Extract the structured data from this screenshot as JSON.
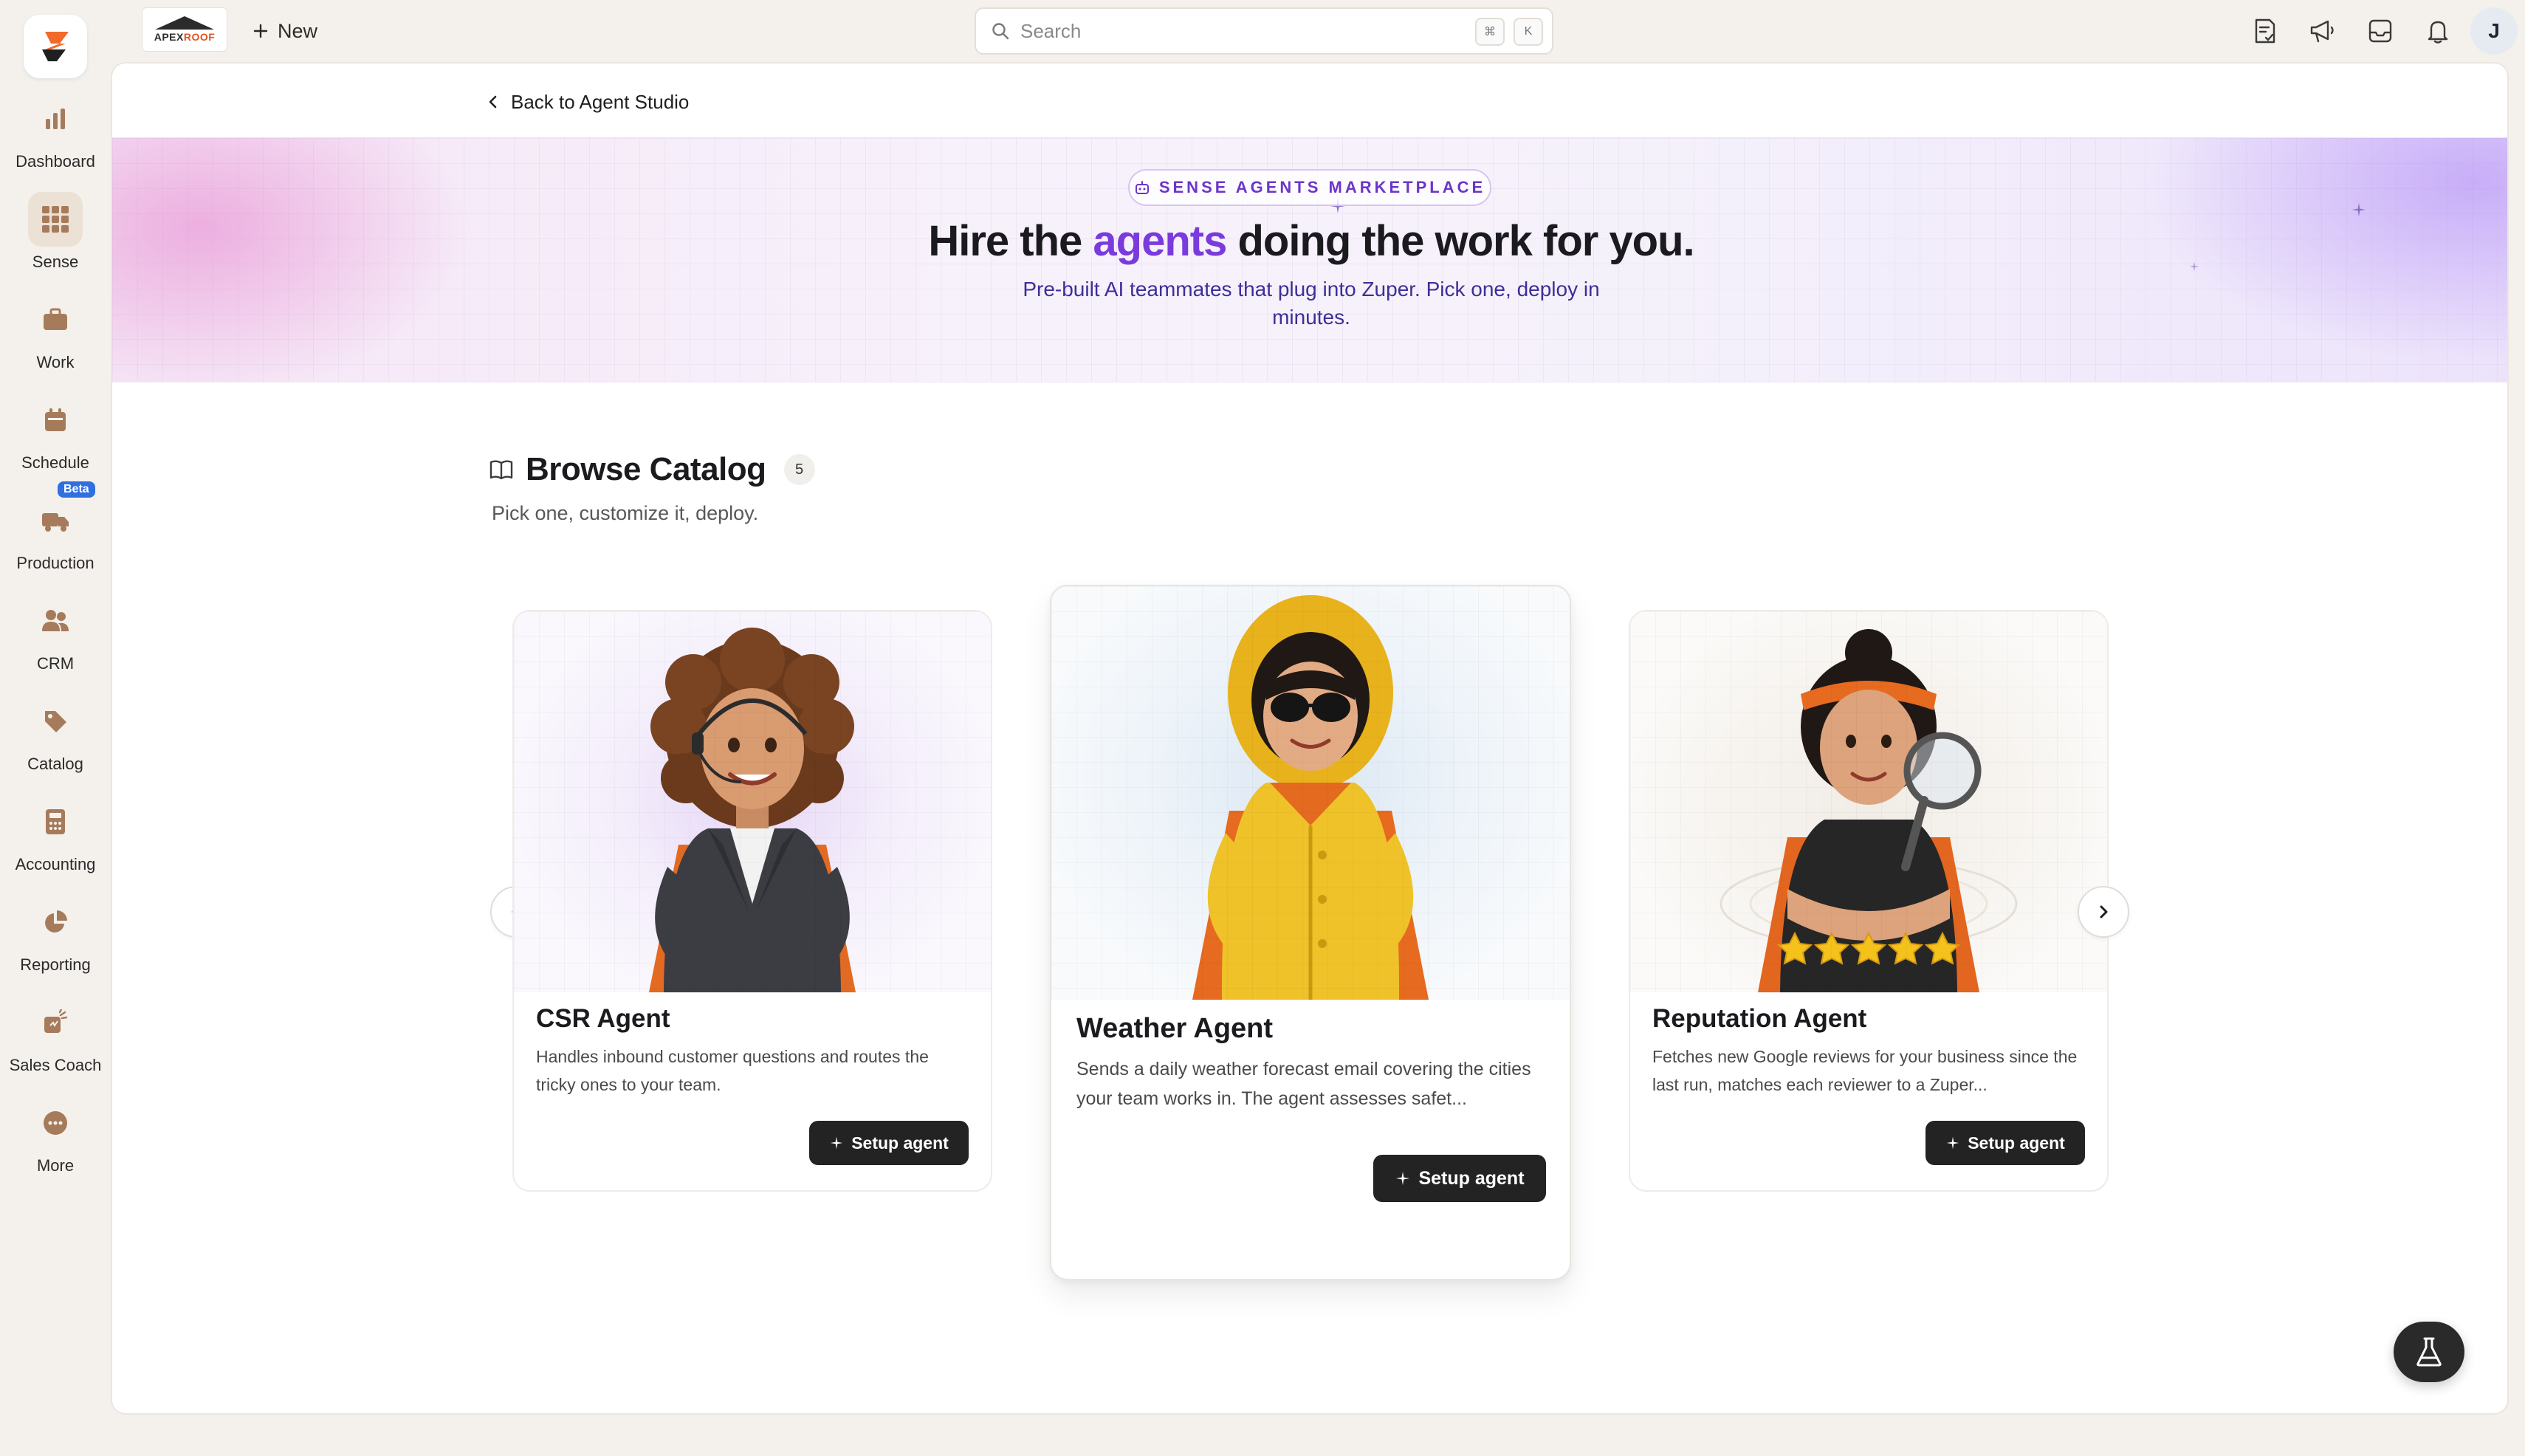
{
  "sidebar": {
    "items": [
      {
        "label": "Dashboard",
        "icon": "bar-chart-icon"
      },
      {
        "label": "Sense",
        "icon": "grid-icon",
        "active": true
      },
      {
        "label": "Work",
        "icon": "briefcase-icon"
      },
      {
        "label": "Schedule",
        "icon": "calendar-icon"
      },
      {
        "label": "Production",
        "icon": "truck-icon",
        "badge": "Beta"
      },
      {
        "label": "CRM",
        "icon": "users-icon"
      },
      {
        "label": "Catalog",
        "icon": "tag-icon"
      },
      {
        "label": "Accounting",
        "icon": "calculator-icon"
      },
      {
        "label": "Reporting",
        "icon": "pie-chart-icon"
      },
      {
        "label": "Sales Coach",
        "icon": "megaphone-icon"
      },
      {
        "label": "More",
        "icon": "more-icon"
      }
    ]
  },
  "topbar": {
    "company_logo": {
      "word1": "APEX",
      "word2": "ROOF"
    },
    "new_label": "New",
    "search_placeholder": "Search",
    "search_kbd_1": "⌘",
    "search_kbd_2": "K",
    "avatar_initial": "J"
  },
  "main": {
    "back_label": "Back to Agent Studio",
    "hero": {
      "badge": "SENSE AGENTS MARKETPLACE",
      "title_before": "Hire the ",
      "title_highlight": "agents",
      "title_after": " doing the work for you.",
      "subtitle": "Pre-built AI teammates that plug into Zuper. Pick one, deploy in minutes."
    },
    "catalog": {
      "title": "Browse Catalog",
      "count": "5",
      "subtitle": "Pick one, customize it, deploy."
    },
    "cards": [
      {
        "name": "CSR Agent",
        "description": "Handles inbound customer questions and routes the tricky ones to your team.",
        "button": "Setup agent"
      },
      {
        "name": "Weather Agent",
        "description": "Sends a daily weather forecast email covering the cities your team works in. The agent assesses safet...",
        "button": "Setup agent"
      },
      {
        "name": "Reputation Agent",
        "description": "Fetches new Google reviews for your business since the last run, matches each reviewer to a Zuper...",
        "button": "Setup agent"
      }
    ]
  },
  "colors": {
    "accent_purple": "#7a3bdd",
    "brand_orange": "#e4541c",
    "button_dark": "#232323"
  }
}
